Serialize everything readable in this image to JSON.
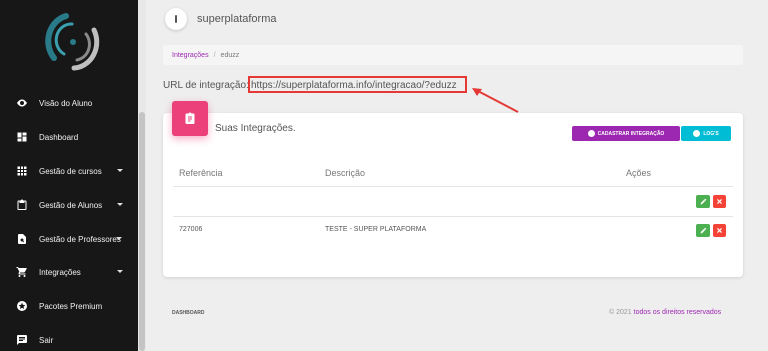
{
  "header": {
    "brand": "superplataforma"
  },
  "sidebar": {
    "items": [
      {
        "label": "Visão do Aluno",
        "icon": "eye-icon",
        "caret": false
      },
      {
        "label": "Dashboard",
        "icon": "dashboard-icon",
        "caret": false
      },
      {
        "label": "Gestão de cursos",
        "icon": "grid-icon",
        "caret": true
      },
      {
        "label": "Gestão de Alunos",
        "icon": "clipboard-icon",
        "caret": true
      },
      {
        "label": "Gestão de Professores",
        "icon": "search-doc-icon",
        "caret": true
      },
      {
        "label": "Integrações",
        "icon": "cart-icon",
        "caret": true
      },
      {
        "label": "Pacotes Premium",
        "icon": "star-circle-icon",
        "caret": false
      },
      {
        "label": "Sair",
        "icon": "chat-icon",
        "caret": false
      }
    ]
  },
  "breadcrumb": {
    "parent": "Integrações",
    "separator": "/",
    "current": "eduzz"
  },
  "integration_url": {
    "label": "URL de integração:",
    "value": "https://superplataforma.info/integracao/?eduzz"
  },
  "card": {
    "title": "Suas Integrações.",
    "register_button": "CADASTRAR INTEGRAÇÃO",
    "logs_button": "LOG'S",
    "columns": [
      "Referência",
      "Descrição",
      "Ações"
    ],
    "rows": [
      {
        "reference": "",
        "description": ""
      },
      {
        "reference": "727006",
        "description": "TESTE - SUPER PLATAFORMA"
      }
    ]
  },
  "footer": {
    "left": "DASHBOARD",
    "copyright_prefix": "© 2021",
    "copyright_text": "todos os direitos reservados"
  },
  "colors": {
    "sidebar_bg": "#171717",
    "accent_purple": "#9c27b0",
    "accent_cyan": "#00bcd4",
    "card_icon_pink": "#ec407a",
    "highlight_red": "#e53935",
    "edit_green": "#4caf50",
    "delete_red": "#f44336"
  }
}
